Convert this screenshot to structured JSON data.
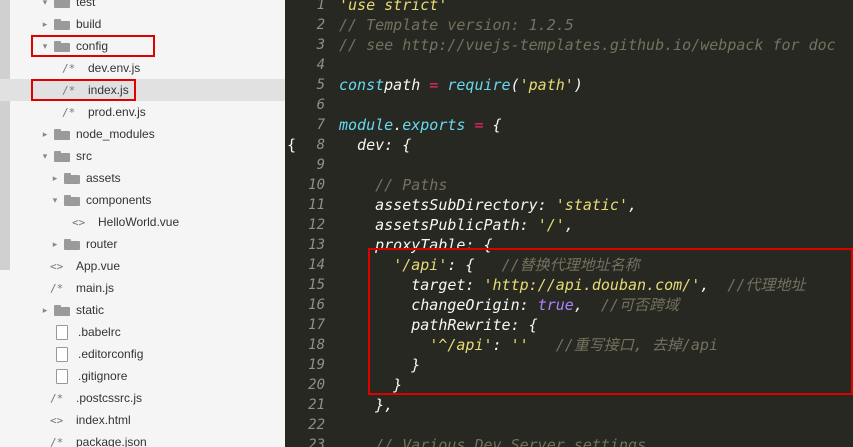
{
  "sidebar": {
    "items": [
      {
        "label": "test",
        "type": "folder",
        "arrow": "▾"
      },
      {
        "label": "build",
        "type": "folder",
        "arrow": "▸"
      },
      {
        "label": "config",
        "type": "folder",
        "arrow": "▾"
      },
      {
        "label": "dev.env.js",
        "type": "js",
        "icon": "/*"
      },
      {
        "label": "index.js",
        "type": "js",
        "icon": "/*",
        "selected": true
      },
      {
        "label": "prod.env.js",
        "type": "js",
        "icon": "/*"
      },
      {
        "label": "node_modules",
        "type": "folder",
        "arrow": "▸"
      },
      {
        "label": "src",
        "type": "folder",
        "arrow": "▾"
      },
      {
        "label": "assets",
        "type": "folder",
        "arrow": "▸"
      },
      {
        "label": "components",
        "type": "folder",
        "arrow": "▾"
      },
      {
        "label": "HelloWorld.vue",
        "type": "vue",
        "icon": "<>"
      },
      {
        "label": "router",
        "type": "folder",
        "arrow": "▸"
      },
      {
        "label": "App.vue",
        "type": "vue",
        "icon": "<>"
      },
      {
        "label": "main.js",
        "type": "js",
        "icon": "/*"
      },
      {
        "label": "static",
        "type": "folder",
        "arrow": "▸"
      },
      {
        "label": ".babelrc",
        "type": "doc"
      },
      {
        "label": ".editorconfig",
        "type": "doc"
      },
      {
        "label": ".gitignore",
        "type": "doc"
      },
      {
        "label": ".postcssrc.js",
        "type": "js",
        "icon": "/*"
      },
      {
        "label": "index.html",
        "type": "vue",
        "icon": "<>"
      },
      {
        "label": "package.json",
        "type": "js",
        "icon": "/*"
      }
    ]
  },
  "editor": {
    "gutter_brace": "{",
    "lines": [
      {
        "n": "1",
        "tokens": [
          [
            "str",
            "'use strict'"
          ]
        ]
      },
      {
        "n": "2",
        "tokens": [
          [
            "cm",
            "// Template version: 1.2.5"
          ]
        ]
      },
      {
        "n": "3",
        "tokens": [
          [
            "cm",
            "// see http://vuejs-templates.github.io/webpack for doc"
          ]
        ]
      },
      {
        "n": "4",
        "tokens": []
      },
      {
        "n": "5",
        "tokens": [
          [
            "kw",
            "const"
          ],
          [
            "",
            "path"
          ],
          [
            "op",
            " = "
          ],
          [
            "fn",
            "require"
          ],
          [
            "",
            "("
          ],
          [
            "str",
            "'path'"
          ],
          [
            "",
            ")"
          ]
        ]
      },
      {
        "n": "6",
        "tokens": []
      },
      {
        "n": "7",
        "tokens": [
          [
            "fn",
            "module"
          ],
          [
            "",
            "."
          ],
          [
            "fn",
            "exports"
          ],
          [
            "op",
            " = "
          ],
          [
            "",
            "{"
          ]
        ]
      },
      {
        "n": "8",
        "tokens": [
          [
            "",
            "  dev: {"
          ]
        ]
      },
      {
        "n": "9",
        "tokens": []
      },
      {
        "n": "10",
        "tokens": [
          [
            "cm",
            "    // Paths"
          ]
        ]
      },
      {
        "n": "11",
        "tokens": [
          [
            "",
            "    assetsSubDirectory: "
          ],
          [
            "str",
            "'static'"
          ],
          [
            "",
            ","
          ]
        ]
      },
      {
        "n": "12",
        "tokens": [
          [
            "",
            "    assetsPublicPath: "
          ],
          [
            "str",
            "'/'"
          ],
          [
            "",
            ","
          ]
        ]
      },
      {
        "n": "13",
        "tokens": [
          [
            "",
            "    proxyTable: {"
          ]
        ]
      },
      {
        "n": "14",
        "tokens": [
          [
            "",
            "      "
          ],
          [
            "str",
            "'/api'"
          ],
          [
            "",
            ": {   "
          ],
          [
            "cm",
            "//替换代理地址名称"
          ]
        ]
      },
      {
        "n": "15",
        "tokens": [
          [
            "",
            "        target: "
          ],
          [
            "str",
            "'http://api.douban.com/'"
          ],
          [
            "",
            ",  "
          ],
          [
            "cm",
            "//代理地址"
          ]
        ]
      },
      {
        "n": "16",
        "tokens": [
          [
            "",
            "        changeOrigin: "
          ],
          [
            "bool",
            "true"
          ],
          [
            "",
            ",  "
          ],
          [
            "cm",
            "//可否跨域"
          ]
        ]
      },
      {
        "n": "17",
        "tokens": [
          [
            "",
            "        pathRewrite: {"
          ]
        ]
      },
      {
        "n": "18",
        "tokens": [
          [
            "",
            "          "
          ],
          [
            "str",
            "'^/api'"
          ],
          [
            "",
            ": "
          ],
          [
            "str",
            "''"
          ],
          [
            "",
            "   "
          ],
          [
            "cm",
            "//重写接口, 去掉/api"
          ]
        ]
      },
      {
        "n": "19",
        "tokens": [
          [
            "",
            "        }"
          ]
        ]
      },
      {
        "n": "20",
        "tokens": [
          [
            "",
            "      }"
          ]
        ]
      },
      {
        "n": "21",
        "tokens": [
          [
            "",
            "    },"
          ]
        ]
      },
      {
        "n": "22",
        "tokens": []
      },
      {
        "n": "23",
        "tokens": [
          [
            "cm",
            "    // Various Dev Server settings"
          ]
        ]
      }
    ]
  },
  "colors": {
    "highlight_box": "#e00000",
    "editor_bg": "#272822",
    "sidebar_bg": "#f5f5f5"
  }
}
